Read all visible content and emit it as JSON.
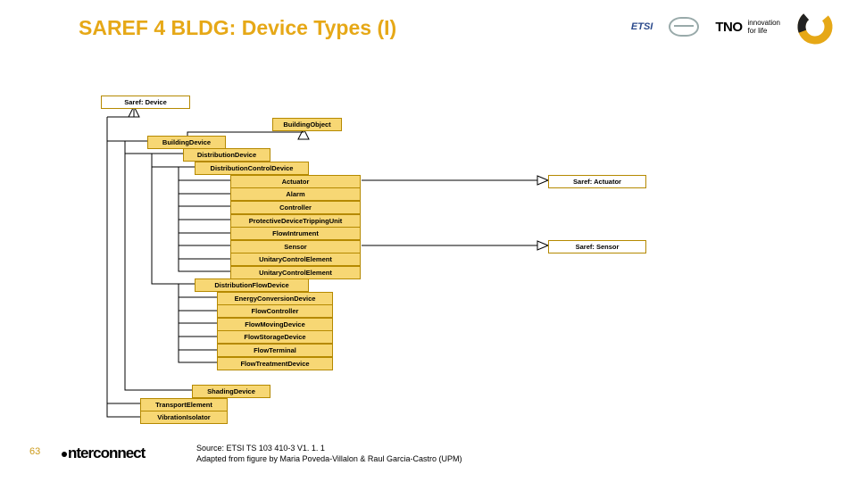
{
  "title": "SAREF 4 BLDG: Device Types (I)",
  "page_num": "63",
  "source_line1": "Source: ETSI TS 103 410-3 V1. 1. 1",
  "source_line2": "Adapted from figure by Maria Poveda-Villalon & Raul Garcia-Castro (UPM)",
  "brand": "nterconnect",
  "logos": {
    "etsi": "ETSI",
    "tno": "TNO",
    "ifl1": "innovation",
    "ifl2": "for life"
  },
  "nodes": {
    "saref_device": "Saref: Device",
    "building_object": "BuildingObject",
    "building_device": "BuildingDevice",
    "distribution_device": "DistributionDevice",
    "dist_control_device": "DistributionControlDevice",
    "actuator": "Actuator",
    "saref_actuator": "Saref: Actuator",
    "alarm": "Alarm",
    "controller": "Controller",
    "protective": "ProtectiveDeviceTrippingUnit",
    "flowinstrument": "FlowIntrument",
    "sensor": "Sensor",
    "saref_sensor": "Saref: Sensor",
    "unitary": "UnitaryControlElement",
    "dist_flow_device": "DistributionFlowDevice",
    "energy_conv": "EnergyConversionDevice",
    "flow_controller": "FlowController",
    "flow_moving": "FlowMovingDevice",
    "flow_storage": "FlowStorageDevice",
    "flow_terminal": "FlowTerminal",
    "flow_treatment": "FlowTreatmentDevice",
    "shading": "ShadingDevice",
    "transport": "TransportElement",
    "vibration": "VibrationIsolator"
  }
}
